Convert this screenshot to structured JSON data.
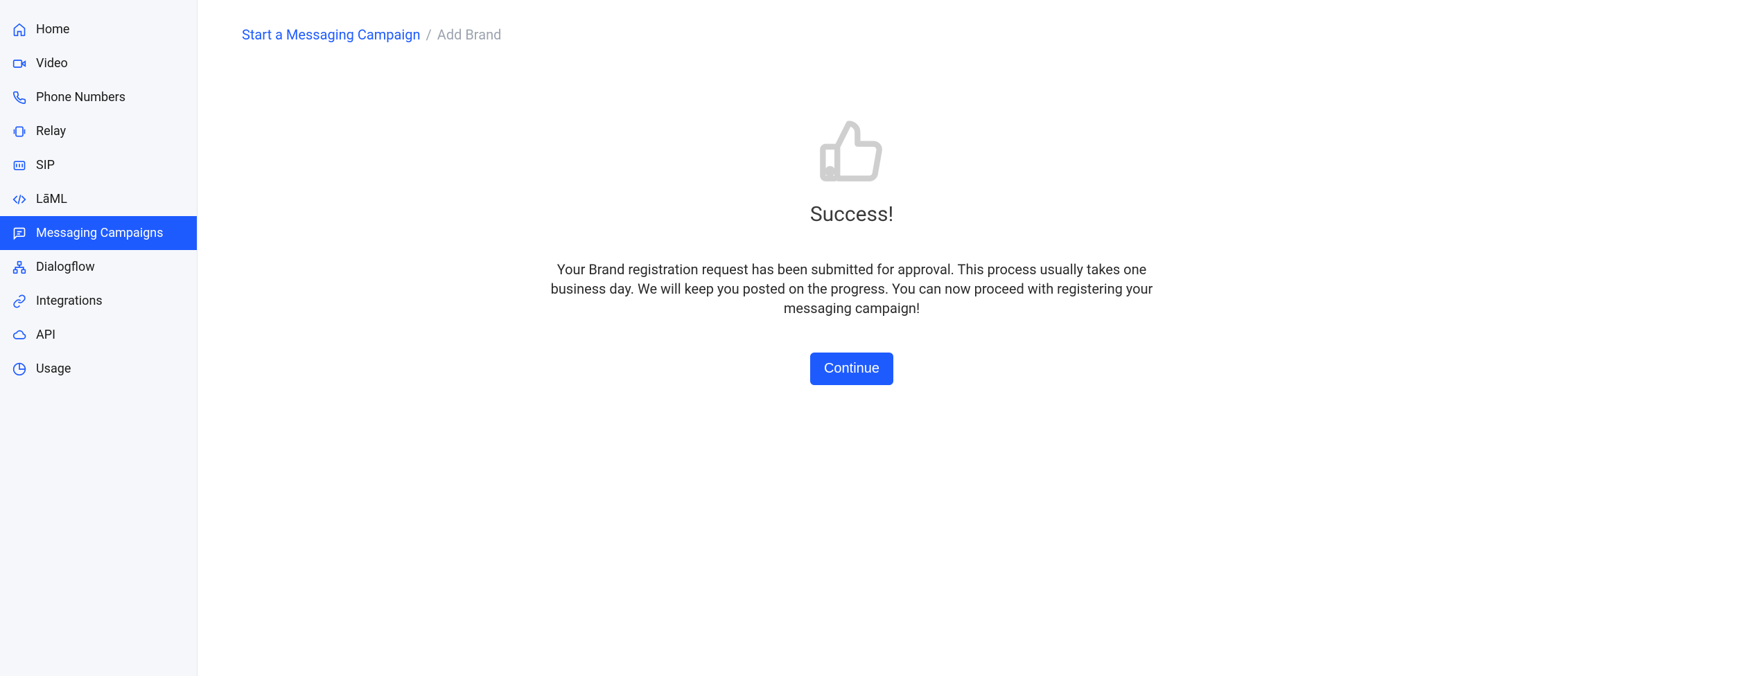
{
  "sidebar": {
    "items": [
      {
        "label": "Home",
        "icon": "home-icon"
      },
      {
        "label": "Video",
        "icon": "video-icon"
      },
      {
        "label": "Phone Numbers",
        "icon": "phone-icon"
      },
      {
        "label": "Relay",
        "icon": "relay-icon"
      },
      {
        "label": "SIP",
        "icon": "sip-icon"
      },
      {
        "label": "LāML",
        "icon": "code-icon"
      },
      {
        "label": "Messaging Campaigns",
        "icon": "message-icon",
        "active": true
      },
      {
        "label": "Dialogflow",
        "icon": "dialogflow-icon"
      },
      {
        "label": "Integrations",
        "icon": "integrations-icon"
      },
      {
        "label": "API",
        "icon": "cloud-icon"
      },
      {
        "label": "Usage",
        "icon": "usage-icon"
      }
    ]
  },
  "breadcrumb": {
    "link": "Start a Messaging Campaign",
    "separator": "/",
    "current": "Add Brand"
  },
  "main": {
    "title": "Success!",
    "message": "Your Brand registration request has been submitted for approval. This process usually takes one business day. We will keep you posted on the progress. You can now proceed with registering your messaging campaign!",
    "continue_label": "Continue"
  }
}
